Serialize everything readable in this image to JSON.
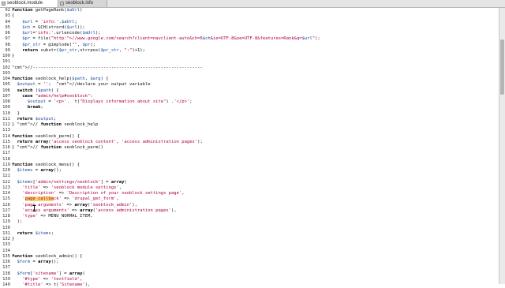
{
  "tabs": [
    {
      "label": "seoblock.module",
      "active": true
    },
    {
      "label": "seoblock.info",
      "active": false
    }
  ],
  "lines": [
    {
      "n": "92",
      "t": "function getPageRank($aUrl)"
    },
    {
      "n": "93",
      "t": "{"
    },
    {
      "n": "94",
      "t": "    $url = 'info:'.$aUrl;"
    },
    {
      "n": "95",
      "t": "    $ch = GCH(strord($url));"
    },
    {
      "n": "96",
      "t": "    $url='info:'.urlencode($aUrl);"
    },
    {
      "n": "97",
      "t": "    $pr = file(\"http://www.google.com/search?client=navclient-auto&ch=6$ch&ie=UTF-8&oe=UTF-8&features=Rank&q=$url\");"
    },
    {
      "n": "98",
      "t": "    $pr_str = @implode(\"\", $pr);"
    },
    {
      "n": "99",
      "t": "    return substr($pr_str,strrpos($pr_str, \":\")+1);"
    },
    {
      "n": "100",
      "t": "}"
    },
    {
      "n": "101",
      "t": ""
    },
    {
      "n": "102",
      "t": "//-----------------------------------------------------------------"
    },
    {
      "n": "103",
      "t": ""
    },
    {
      "n": "104",
      "t": "function seoblock_help($path, $arg) {"
    },
    {
      "n": "105",
      "t": "  $output = '';  //declare your output variable"
    },
    {
      "n": "106",
      "t": "  switch ($path) {"
    },
    {
      "n": "107",
      "t": "    case \"admin/help#seoblock\":"
    },
    {
      "n": "108",
      "t": "      $output = '<p>'.  t(\"Displays information about site\") .'</p>';"
    },
    {
      "n": "109",
      "t": "      break;"
    },
    {
      "n": "110",
      "t": "  }"
    },
    {
      "n": "111",
      "t": "  return $output;"
    },
    {
      "n": "112",
      "t": "} // function seoblock_help"
    },
    {
      "n": "113",
      "t": ""
    },
    {
      "n": "114",
      "t": "function seoblock_perm() {"
    },
    {
      "n": "115",
      "t": "  return array('access seoblock content', 'access administration pages');"
    },
    {
      "n": "116",
      "t": "} // function seoblock_perm()"
    },
    {
      "n": "117",
      "t": ""
    },
    {
      "n": "118",
      "t": ""
    },
    {
      "n": "119",
      "t": "function seoblock_menu() {"
    },
    {
      "n": "120",
      "t": "  $items = array();"
    },
    {
      "n": "121",
      "t": ""
    },
    {
      "n": "122",
      "t": "  $items['admin/settings/seoblock'] = array("
    },
    {
      "n": "123",
      "t": "    'title' => 'seoblock module settings',"
    },
    {
      "n": "124",
      "t": "    'description' => 'Description of your seoblock settings page',"
    },
    {
      "n": "125",
      "t": "    'page callback' => 'drupal_get_form',"
    },
    {
      "n": "126",
      "t": "    'page arguments' => array('seoblock_admin'),"
    },
    {
      "n": "127",
      "t": "    'access arguments' => array('access administration pages'),"
    },
    {
      "n": "128",
      "t": "    'type' => MENU_NORMAL_ITEM,"
    },
    {
      "n": "129",
      "t": "  );"
    },
    {
      "n": "130",
      "t": ""
    },
    {
      "n": "131",
      "t": "  return $items;"
    },
    {
      "n": "132",
      "t": "}"
    },
    {
      "n": "133",
      "t": ""
    },
    {
      "n": "134",
      "t": ""
    },
    {
      "n": "135",
      "t": "function seoblock_admin() {"
    },
    {
      "n": "136",
      "t": "  $form = array();"
    },
    {
      "n": "137",
      "t": ""
    },
    {
      "n": "138",
      "t": "  $form['sitename'] = array("
    },
    {
      "n": "139",
      "t": "    '#type' => 'textfield',"
    },
    {
      "n": "140",
      "t": "    '#title' => t('Sitename'),"
    }
  ],
  "selection": {
    "line": "125",
    "text": "page callba"
  },
  "icons": {
    "tab": "file-icon",
    "cursor": "text-cursor-icon"
  }
}
